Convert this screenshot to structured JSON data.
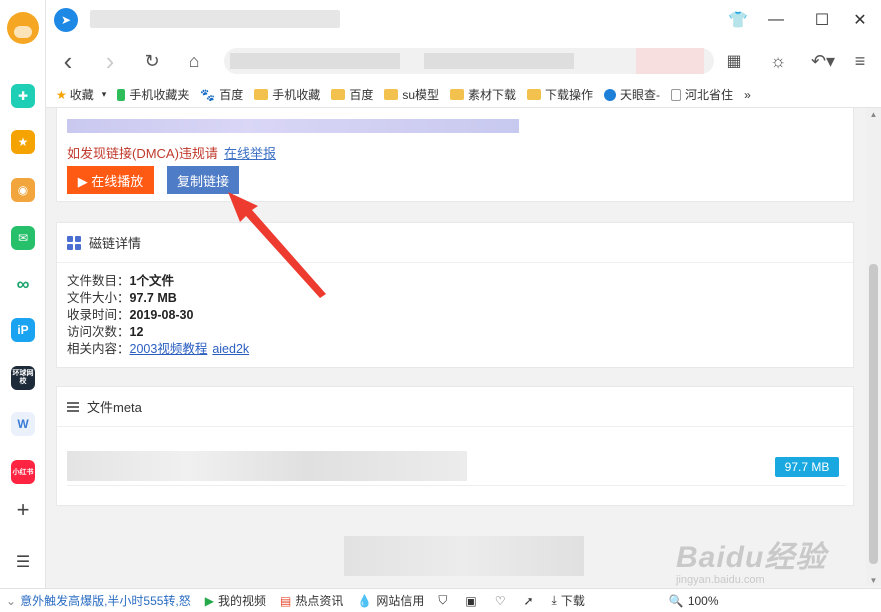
{
  "sidebar": {
    "icons": [
      {
        "name": "avatar",
        "color": "#f5a623"
      },
      {
        "name": "medical-cross-icon",
        "color": "#1fcfb5"
      },
      {
        "name": "star-icon",
        "color": "#f5a300"
      },
      {
        "name": "weibo-icon",
        "color": "#f2a53c"
      },
      {
        "name": "mail-icon",
        "color": "#26c06b"
      },
      {
        "name": "link-icon",
        "color": "#1aa36b"
      },
      {
        "name": "ip-icon",
        "color": "#1aa3f0"
      },
      {
        "name": "news-icon",
        "color": "#1d2a3a"
      },
      {
        "name": "word-doc-icon",
        "color": "#3a7bd5"
      },
      {
        "name": "xiaohongshu-icon",
        "color": "#ff2442"
      }
    ],
    "news_label": "环球网校",
    "xhs_label": "小红书",
    "add_symbol": "+",
    "menu_symbol": "☰"
  },
  "toolbar": {
    "back": "‹",
    "forward": "›",
    "refresh": "↻",
    "home": "⌂"
  },
  "window": {
    "minimize": "—",
    "maximize": "☐",
    "close": "✕"
  },
  "bookmarks": [
    {
      "label": "收藏",
      "icon": "star-icon"
    },
    {
      "label": "手机收藏夹",
      "icon": "phone-icon"
    },
    {
      "label": "百度",
      "icon": "baidu-paw-icon"
    },
    {
      "label": "手机收藏",
      "icon": "folder-icon"
    },
    {
      "label": "百度",
      "icon": "folder-icon"
    },
    {
      "label": "su模型",
      "icon": "folder-icon"
    },
    {
      "label": "素材下载",
      "icon": "folder-icon"
    },
    {
      "label": "下载操作",
      "icon": "folder-icon"
    },
    {
      "label": "天眼查-",
      "icon": "edge-icon"
    },
    {
      "label": "河北省住",
      "icon": "page-icon"
    }
  ],
  "bookmarks_more": "»",
  "content": {
    "dmca_text": "如发现链接(DMCA)违规请",
    "dmca_link": "在线举报",
    "play_button": "▶ 在线播放",
    "copy_button": "复制链接",
    "details_title": "磁链详情",
    "details": [
      {
        "label": "文件数目：",
        "value": "1个文件"
      },
      {
        "label": "文件大小：",
        "value": "97.7 MB"
      },
      {
        "label": "收录时间：",
        "value": "2019-08-30"
      },
      {
        "label": "访问次数：",
        "value": "12"
      }
    ],
    "related_label": "相关内容：",
    "related_links": [
      "2003视频教程",
      "aied2k"
    ],
    "meta_title": "文件meta",
    "file_size_badge": "97.7 MB"
  },
  "statusbar": {
    "news": "意外触发高爆版,半小时555转,怒",
    "items": [
      "我的视频",
      "热点资讯",
      "网站信用",
      "下载"
    ],
    "zoom": "100%"
  },
  "watermark": {
    "logo": "Baidu经验",
    "url": "jingyan.baidu.com"
  }
}
